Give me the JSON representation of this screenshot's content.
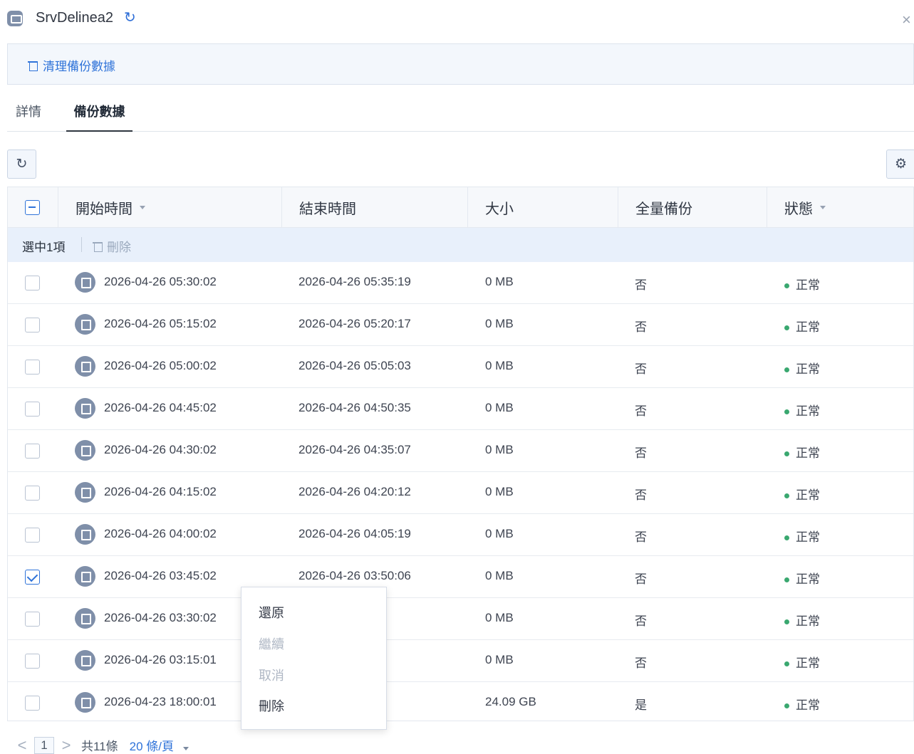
{
  "window": {
    "title": "SrvDelinea2",
    "refresh_icon": "refresh-icon",
    "close_icon": "close-icon"
  },
  "toolbar": {
    "clean_label": "清理備份數據"
  },
  "tabs": [
    {
      "label": "詳情"
    },
    {
      "label": "備份數據"
    }
  ],
  "table": {
    "headers": [
      "開始時間",
      "結束時間",
      "大小",
      "全量備份",
      "狀態"
    ],
    "selection_text": "選中1項",
    "delete_label": "刪除",
    "rows": [
      {
        "start": "2026-04-26 05:30:02",
        "end": "2026-04-26 05:35:19",
        "size": "0 MB",
        "full": "否",
        "status": "正常",
        "checked": false
      },
      {
        "start": "2026-04-26 05:15:02",
        "end": "2026-04-26 05:20:17",
        "size": "0 MB",
        "full": "否",
        "status": "正常",
        "checked": false
      },
      {
        "start": "2026-04-26 05:00:02",
        "end": "2026-04-26 05:05:03",
        "size": "0 MB",
        "full": "否",
        "status": "正常",
        "checked": false
      },
      {
        "start": "2026-04-26 04:45:02",
        "end": "2026-04-26 04:50:35",
        "size": "0 MB",
        "full": "否",
        "status": "正常",
        "checked": false
      },
      {
        "start": "2026-04-26 04:30:02",
        "end": "2026-04-26 04:35:07",
        "size": "0 MB",
        "full": "否",
        "status": "正常",
        "checked": false
      },
      {
        "start": "2026-04-26 04:15:02",
        "end": "2026-04-26 04:20:12",
        "size": "0 MB",
        "full": "否",
        "status": "正常",
        "checked": false
      },
      {
        "start": "2026-04-26 04:00:02",
        "end": "2026-04-26 04:05:19",
        "size": "0 MB",
        "full": "否",
        "status": "正常",
        "checked": false
      },
      {
        "start": "2026-04-26 03:45:02",
        "end": "2026-04-26 03:50:06",
        "size": "0 MB",
        "full": "否",
        "status": "正常",
        "checked": true
      },
      {
        "start": "2026-04-26 03:30:02",
        "end": ":35:24",
        "size": "0 MB",
        "full": "否",
        "status": "正常",
        "checked": false
      },
      {
        "start": "2026-04-26 03:15:01",
        "end": ":19:57",
        "size": "0 MB",
        "full": "否",
        "status": "正常",
        "checked": false
      },
      {
        "start": "2026-04-23 18:00:01",
        "end": ":10:25",
        "size": "24.09 GB",
        "full": "是",
        "status": "正常",
        "checked": false
      }
    ]
  },
  "context_menu": [
    {
      "label": "還原",
      "disabled": false
    },
    {
      "label": "繼續",
      "disabled": true
    },
    {
      "label": "取消",
      "disabled": true
    },
    {
      "label": "刪除",
      "disabled": false
    }
  ],
  "pagination": {
    "prev": "<",
    "current_page": "1",
    "next": ">",
    "total": "共11條",
    "page_size": "20 條/頁"
  },
  "colors": {
    "accent": "#2f73d9",
    "status_ok": "#3aa870"
  }
}
